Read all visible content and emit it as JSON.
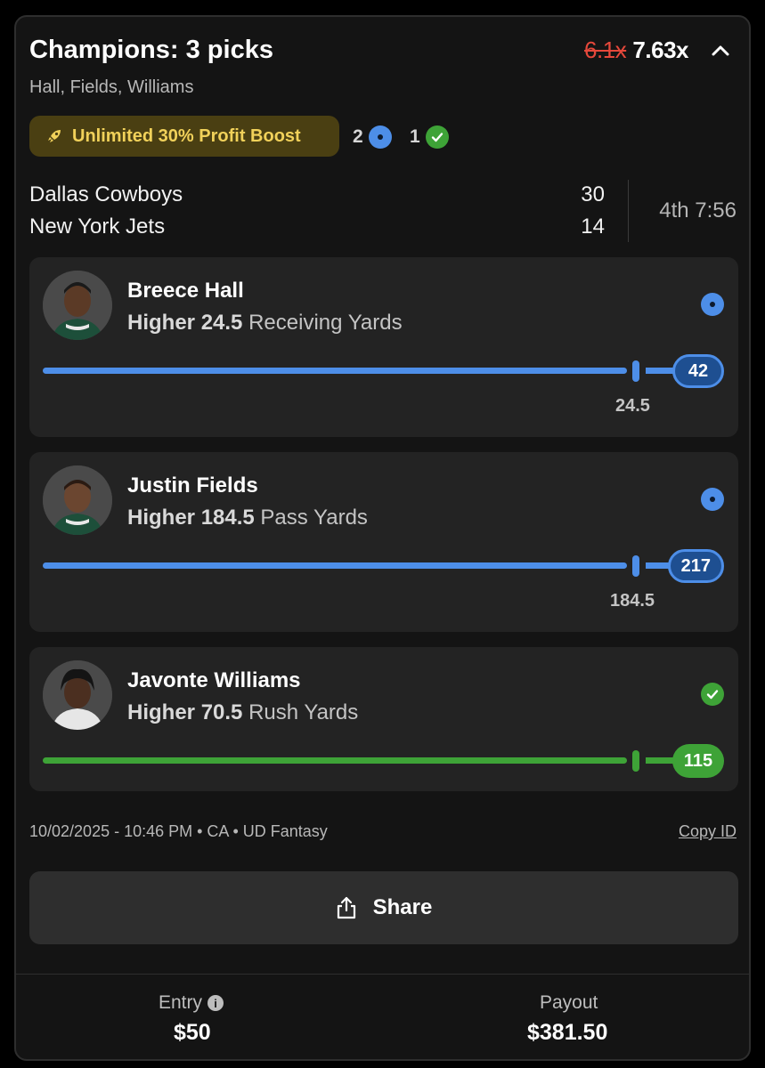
{
  "header": {
    "title": "Champions: 3 picks",
    "multiplier_old": "6.1x",
    "multiplier_new": "7.63x",
    "subtitle": "Hall, Fields, Williams"
  },
  "boost": {
    "label": "Unlimited 30% Profit Boost",
    "icon": "rocket-icon"
  },
  "counts": {
    "pending": "2",
    "won": "1"
  },
  "game": {
    "team1": "Dallas Cowboys",
    "score1": "30",
    "team2": "New York Jets",
    "score2": "14",
    "clock": "4th 7:56"
  },
  "picks": [
    {
      "name": "Breece Hall",
      "direction": "Higher",
      "line": "24.5",
      "stat": "Receiving Yards",
      "current": "42",
      "status": "pending",
      "line_label": "24.5"
    },
    {
      "name": "Justin Fields",
      "direction": "Higher",
      "line": "184.5",
      "stat": "Pass Yards",
      "current": "217",
      "status": "pending",
      "line_label": "184.5"
    },
    {
      "name": "Javonte Williams",
      "direction": "Higher",
      "line": "70.5",
      "stat": "Rush Yards",
      "current": "115",
      "status": "won",
      "line_label": ""
    }
  ],
  "meta": {
    "info": "10/02/2025 - 10:46 PM • CA • UD Fantasy",
    "copy_id": "Copy ID"
  },
  "share_label": "Share",
  "footer": {
    "entry_label": "Entry",
    "entry_value": "$50",
    "payout_label": "Payout",
    "payout_value": "$381.50"
  },
  "colors": {
    "pending": "#4d8ee8",
    "won": "#3ea337",
    "boost_text": "#f1d15a",
    "boost_bg": "#4a3f12",
    "old_multiplier": "#e5483b"
  }
}
